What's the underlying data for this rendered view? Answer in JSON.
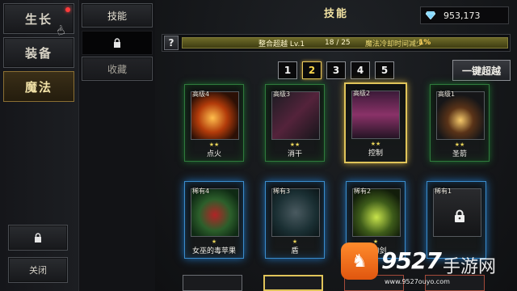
{
  "left_menu": {
    "items": [
      {
        "label": "生长",
        "has_notification": true
      },
      {
        "label": "装备"
      },
      {
        "label": "魔法",
        "active": true
      }
    ],
    "lock_icon": "lock-icon",
    "close_label": "关闭"
  },
  "tabs": {
    "items": [
      "技能",
      "",
      "收藏"
    ],
    "locked_tab_icon": "lock-icon"
  },
  "header": {
    "title": "技能",
    "gems": "953,173",
    "gem_icon": "diamond-icon"
  },
  "info_bar": {
    "help": "?",
    "label": "整合超越",
    "level": "Lv.1",
    "progress_text": "18 / 25",
    "progress": 0.72,
    "effect": "魔法冷却时间减少",
    "percent": "1%"
  },
  "pagination": {
    "pages": [
      "1",
      "2",
      "3",
      "4",
      "5"
    ],
    "active": "2"
  },
  "ascend_button": "一键超越",
  "cards_row1": [
    {
      "rarity": "高级4",
      "stars": "★★",
      "name": "点火"
    },
    {
      "rarity": "高级3",
      "stars": "★★",
      "name": "消干"
    },
    {
      "rarity": "高级2",
      "stars": "★★",
      "name": "控制"
    },
    {
      "rarity": "高级1",
      "stars": "★★",
      "name": "圣箭"
    }
  ],
  "cards_row2": [
    {
      "rarity": "稀有4",
      "stars": "★",
      "name": "女巫的毒苹果"
    },
    {
      "rarity": "稀有3",
      "stars": "★",
      "name": "盾"
    },
    {
      "rarity": "稀有2",
      "stars": "★",
      "name": "王的剑"
    },
    {
      "rarity": "稀有1",
      "stars": "",
      "name": "",
      "locked": true
    }
  ],
  "watermark": {
    "number": "9527",
    "text": "手游网",
    "url": "www.9527ouyo.com"
  },
  "colors": {
    "accent_gold": "#e0c45a",
    "green_glow": "#2f7a3c",
    "blue_glow": "#3a8ccc",
    "progress": "#6d6a29"
  }
}
